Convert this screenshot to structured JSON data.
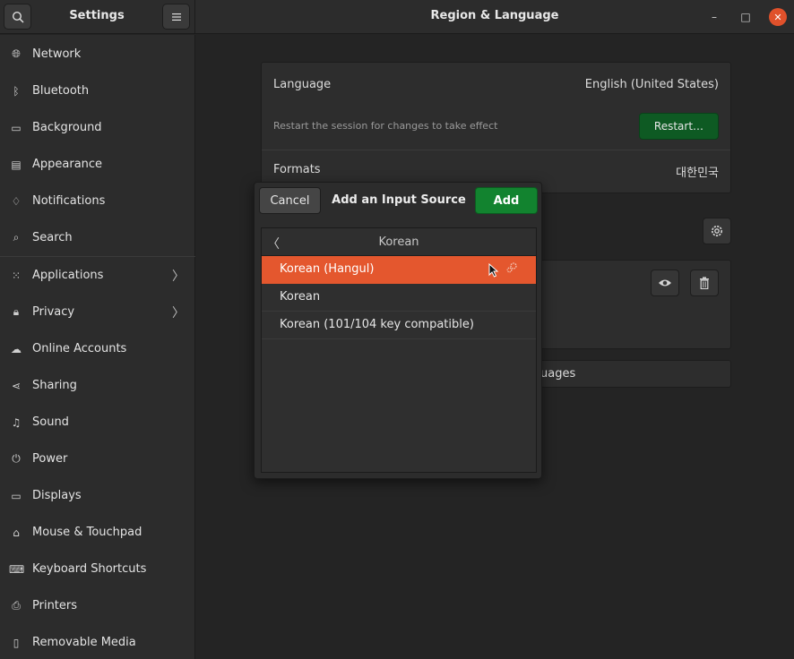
{
  "header": {
    "settings_title": "Settings",
    "panel_title": "Region & Language",
    "search_icon": "search-icon",
    "menu_icon": "hamburger-menu-icon",
    "minimize_glyph": "–",
    "maximize_glyph": "□",
    "close_glyph": "✕"
  },
  "sidebar": {
    "items": [
      {
        "label": "Network",
        "icon": "🌐︎"
      },
      {
        "label": "Bluetooth",
        "icon": "ᛒ"
      },
      {
        "label": "Background",
        "icon": "▭"
      },
      {
        "label": "Appearance",
        "icon": "▤"
      },
      {
        "label": "Notifications",
        "icon": "♢"
      },
      {
        "label": "Search",
        "icon": "⌕"
      },
      {
        "label": "Applications",
        "icon": "⁙",
        "arrow": "〉"
      },
      {
        "label": "Privacy",
        "icon": "🔒︎",
        "arrow": "〉"
      },
      {
        "label": "Online Accounts",
        "icon": "☁"
      },
      {
        "label": "Sharing",
        "icon": "⋖"
      },
      {
        "label": "Sound",
        "icon": "♫"
      },
      {
        "label": "Power",
        "icon": "⏻"
      },
      {
        "label": "Displays",
        "icon": "▭"
      },
      {
        "label": "Mouse & Touchpad",
        "icon": "⌂"
      },
      {
        "label": "Keyboard Shortcuts",
        "icon": "⌨"
      },
      {
        "label": "Printers",
        "icon": "⎙"
      },
      {
        "label": "Removable Media",
        "icon": "▯"
      }
    ]
  },
  "region": {
    "language_label": "Language",
    "language_value": "English (United States)",
    "restart_hint": "Restart the session for changes to take effect",
    "restart_button": "Restart…",
    "formats_label": "Formats",
    "formats_value": "대한민국",
    "manage_languages_partial": "uages"
  },
  "dialog": {
    "cancel": "Cancel",
    "title": "Add an Input Source",
    "add": "Add",
    "list_title": "Korean",
    "back_glyph": "〈",
    "items": [
      {
        "label": "Korean (Hangul)",
        "selected": true
      },
      {
        "label": "Korean",
        "selected": false
      },
      {
        "label": "Korean (101/104 key compatible)",
        "selected": false
      }
    ]
  },
  "colors": {
    "accent_selected": "#e4572e",
    "add_button": "#12832f",
    "restart_button": "#0e5a23"
  }
}
